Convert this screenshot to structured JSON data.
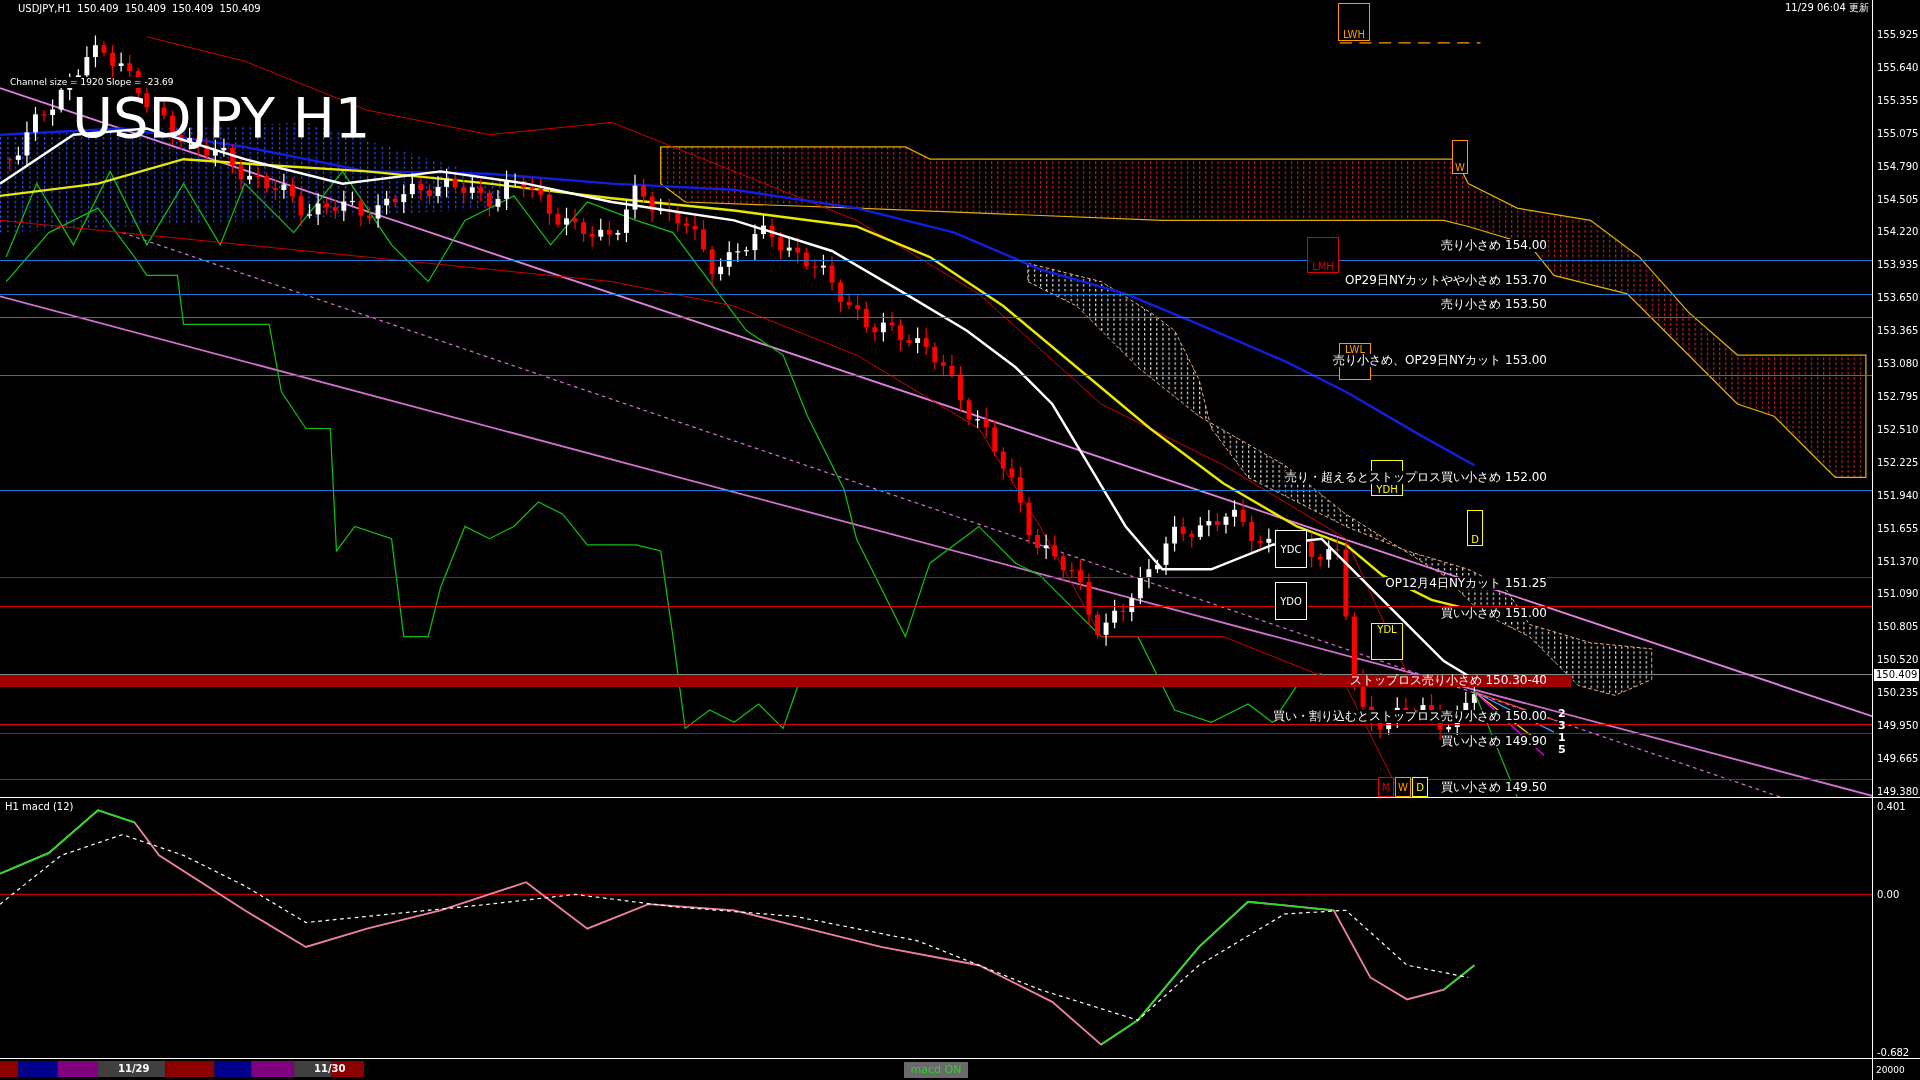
{
  "header": {
    "symbol": "USDJPY,H1",
    "prices": [
      "150.409",
      "150.409",
      "150.409",
      "150.409"
    ]
  },
  "channel_info": "Channel size = 1920 Slope = -23.69",
  "title": "USDJPY H1",
  "updated": "11/29 06:04 更新",
  "levels": [
    {
      "kind": "line",
      "color": "#1e78d8",
      "text": "売り小さめ 154.00"
    },
    {
      "kind": "line",
      "color": "#1e78d8",
      "text": "OP29日NYカットやや小さめ 153.70"
    },
    {
      "kind": "line",
      "color": "#1e78d8",
      "text": "売り小さめ 153.50"
    },
    {
      "kind": "line",
      "color": "#1e78d8",
      "text": "売り小さめ、OP29日NYカット 153.00"
    },
    {
      "kind": "line",
      "color": "#1e78d8",
      "text": "売り・超えるとストップロス買い小さめ 152.00"
    },
    {
      "kind": "line",
      "color": "#e00000",
      "text": "OP12月4日NYカット 151.25"
    },
    {
      "kind": "line",
      "color": "#e00000",
      "text": "買い小さめ 151.00"
    },
    {
      "kind": "band",
      "color": "#a00000",
      "text": "ストップロス売り小さめ 150.30-40"
    },
    {
      "kind": "line",
      "color": "#e00000",
      "text": "買い・割り込むとストップロス売り小さめ 150.00"
    },
    {
      "kind": "line",
      "color": "#e00000",
      "text": "買い小さめ 149.90"
    },
    {
      "kind": "line",
      "color": "#e00000",
      "text": "買い小さめ 149.50"
    }
  ],
  "markers": [
    {
      "label": "LWH",
      "color": "#ff9900"
    },
    {
      "label": "LMH",
      "color": "#e00000"
    },
    {
      "label": "LWL",
      "color": "#ff9900"
    },
    {
      "label": "W",
      "color": "#ff9900"
    },
    {
      "label": "YDH",
      "color": "#ffff00"
    },
    {
      "label": "D",
      "color": "#ffff00"
    },
    {
      "label": "YDC",
      "color": "#ffffff"
    },
    {
      "label": "YDO",
      "color": "#ffffff"
    },
    {
      "label": "YDL",
      "color": "#ffff00"
    },
    {
      "label": "M",
      "color": "#e00000"
    },
    {
      "label": "W",
      "color": "#ff9900"
    },
    {
      "label": "D",
      "color": "#ffff00"
    }
  ],
  "projection_labels": [
    "2",
    "3",
    "1",
    "5"
  ],
  "price_axis": [
    "155.925",
    "155.640",
    "155.355",
    "155.075",
    "154.790",
    "154.505",
    "154.220",
    "153.935",
    "153.650",
    "153.365",
    "153.080",
    "152.795",
    "152.510",
    "152.225",
    "151.940",
    "151.655",
    "151.370",
    "151.090",
    "150.805",
    "150.520",
    "150.235",
    "149.950",
    "149.665",
    "149.380"
  ],
  "current_price": "150.409",
  "macd": {
    "title": "H1 macd (12)",
    "axis": [
      "0.401",
      "0.00",
      "-0.682"
    ]
  },
  "bottom_axis_label": "20000",
  "timeline": {
    "dates": [
      "11/29",
      "11/30"
    ]
  },
  "macd_button": {
    "label": "macd ON"
  }
}
